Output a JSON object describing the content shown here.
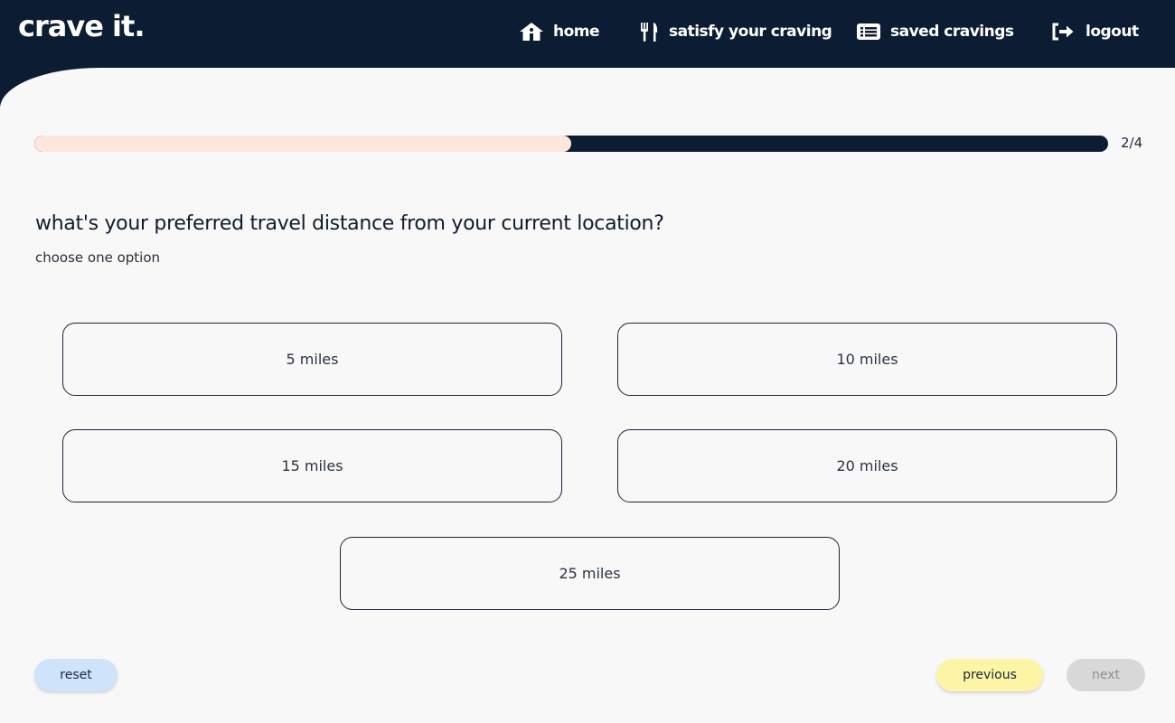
{
  "app": {
    "logo": "crave it.",
    "nav": {
      "home": "home",
      "satisfy": "satisfy your craving",
      "saved": "saved cravings",
      "logout": "logout"
    }
  },
  "progress": {
    "text": "2/4",
    "fraction": 0.5
  },
  "question": {
    "title": "what's your preferred travel distance from your current location?",
    "subtitle": "choose one option",
    "options": [
      "5 miles",
      "10 miles",
      "15 miles",
      "20 miles",
      "25 miles"
    ]
  },
  "buttons": {
    "reset": "reset",
    "previous": "previous",
    "next": "next"
  },
  "colors": {
    "navy": "#0b1c33",
    "progress_fill": "#fde7dd",
    "reset_bg": "#cfe3fb",
    "previous_bg": "#fdf5a6",
    "next_bg": "#d8d8d8"
  }
}
